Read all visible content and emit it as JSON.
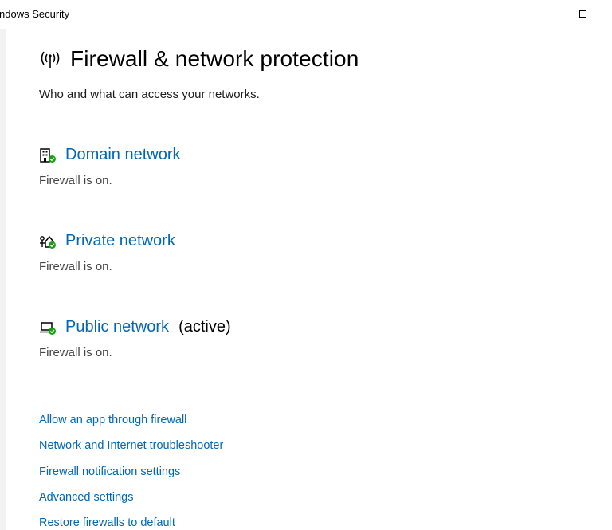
{
  "window": {
    "title": "ndows Security"
  },
  "page": {
    "title": "Firewall & network protection",
    "subtitle": "Who and what can access your networks.",
    "header_icon": "wifi-antenna-icon"
  },
  "networks": [
    {
      "label": "Domain network",
      "status": "Firewall is on.",
      "active_label": "",
      "icon": "domain-building-icon"
    },
    {
      "label": "Private network",
      "status": "Firewall is on.",
      "active_label": "",
      "icon": "private-home-icon"
    },
    {
      "label": "Public network",
      "status": "Firewall is on.",
      "active_label": "(active)",
      "icon": "public-laptop-icon"
    }
  ],
  "links": [
    "Allow an app through firewall",
    "Network and Internet troubleshooter",
    "Firewall notification settings",
    "Advanced settings",
    "Restore firewalls to default"
  ],
  "colors": {
    "link": "#0067b8",
    "status_ok": "#13a10e",
    "text": "#000000",
    "secondary_text": "#444444"
  }
}
